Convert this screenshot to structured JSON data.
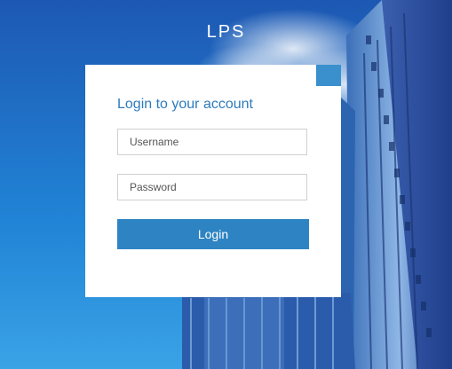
{
  "app": {
    "title": "LPS"
  },
  "login": {
    "heading": "Login to your account",
    "username_placeholder": "Username",
    "password_placeholder": "Password",
    "submit_label": "Login"
  },
  "colors": {
    "accent": "#2e84c3",
    "heading": "#2e7bbd",
    "background_sky": "#1e7dd0"
  }
}
